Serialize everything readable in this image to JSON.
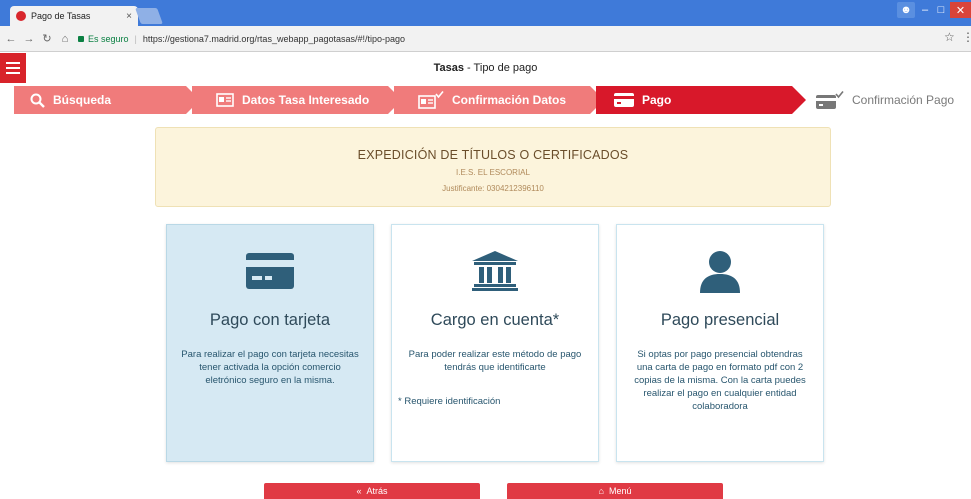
{
  "browser": {
    "tab_title": "Pago de Tasas",
    "tab_close": "×",
    "secure_label": "Es seguro",
    "url": "https://gestiona7.madrid.org/rtas_webapp_pagotasas/#!/tipo-pago"
  },
  "header": {
    "title_bold": "Tasas",
    "title_rest": " - Tipo de pago"
  },
  "steps": [
    {
      "label": "Búsqueda",
      "icon": "search-icon"
    },
    {
      "label": "Datos Tasa Interesado",
      "icon": "id-card-icon"
    },
    {
      "label": "Confirmación Datos",
      "icon": "id-card-check-icon"
    },
    {
      "label": "Pago",
      "icon": "credit-card-icon"
    },
    {
      "label": "Confirmación Pago",
      "icon": "credit-card-check-icon"
    }
  ],
  "info": {
    "title": "EXPEDICIÓN DE TÍTULOS O CERTIFICADOS",
    "school": "I.E.S. EL ESCORIAL",
    "justificante": "Justificante: 0304212396110"
  },
  "cards": [
    {
      "title": "Pago con tarjeta",
      "text": "Para realizar el pago con tarjeta necesitas tener activada la opción comercio eletrónico seguro en la misma.",
      "icon": "credit-card-icon"
    },
    {
      "title": "Cargo en cuenta*",
      "text": "Para poder realizar este método de pago tendrás que identificarte",
      "note": "* Requiere identificación",
      "icon": "bank-icon"
    },
    {
      "title": "Pago presencial",
      "text": "Si optas por pago presencial obtendras una carta de pago en formato pdf con 2 copias de la misma. Con la carta puedes realizar el pago en cualquier entidad colaboradora",
      "icon": "user-icon"
    }
  ],
  "buttons": {
    "back": "Atrás",
    "menu": "Menú"
  },
  "colors": {
    "brand_red": "#d8182a",
    "step_light": "#f07b7b",
    "card_text": "#28566e",
    "info_bg": "#fcf4dc"
  }
}
